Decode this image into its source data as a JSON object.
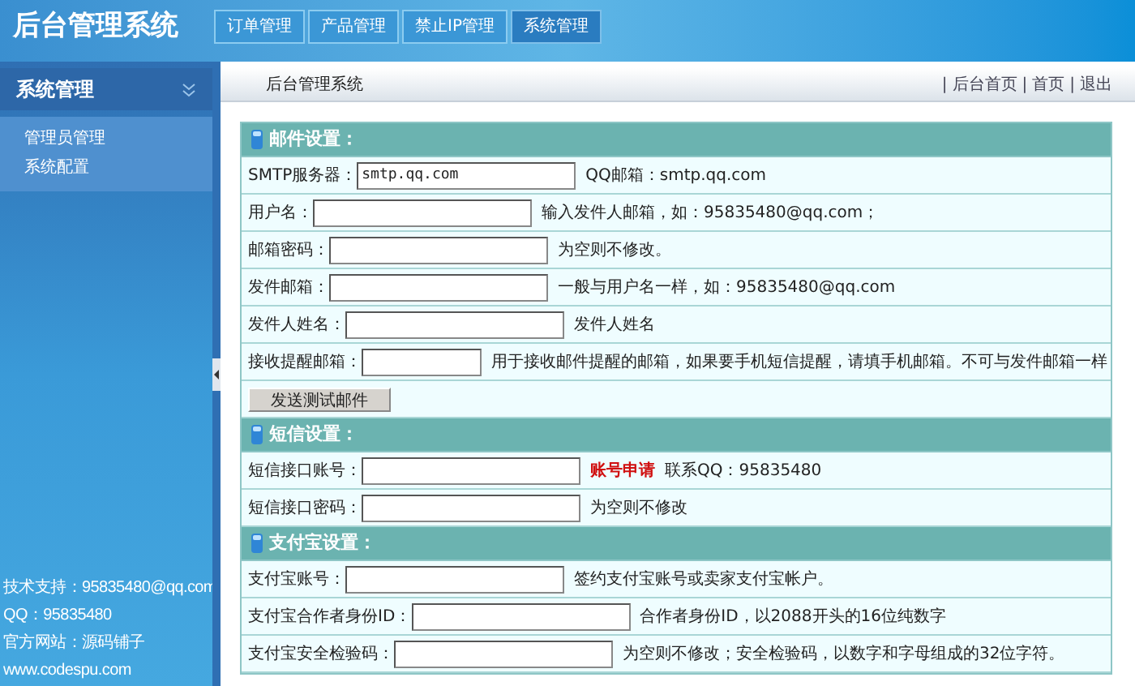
{
  "header": {
    "title": "后台管理系统",
    "tabs": [
      {
        "label": "订单管理",
        "selected": false
      },
      {
        "label": "产品管理",
        "selected": false
      },
      {
        "label": "禁止IP管理",
        "selected": false
      },
      {
        "label": "系统管理",
        "selected": true
      }
    ]
  },
  "sidebar": {
    "title": "系统管理",
    "items": [
      {
        "label": "管理员管理"
      },
      {
        "label": "系统配置"
      }
    ],
    "footer": [
      "技术支持：95835480@qq.com",
      "QQ：95835480",
      "官方网站：源码铺子",
      "www.codespu.com"
    ]
  },
  "topbar": {
    "title": "后台管理系统",
    "separator": "|",
    "links": [
      "后台首页",
      "首页",
      "退出"
    ]
  },
  "sections": [
    {
      "title": "邮件设置：",
      "rows": [
        {
          "kind": "field",
          "label": "SMTP服务器：",
          "value": "smtp.qq.com",
          "hint": "QQ邮箱：smtp.qq.com"
        },
        {
          "kind": "field",
          "label": "用户名：",
          "hint": "输入发件人邮箱，如：95835480@qq.com；"
        },
        {
          "kind": "field",
          "label": "邮箱密码：",
          "hint": "为空则不修改。"
        },
        {
          "kind": "field",
          "label": "发件邮箱：",
          "hint": "一般与用户名一样，如：95835480@qq.com"
        },
        {
          "kind": "field",
          "label": "发件人姓名：",
          "hint": "发件人姓名"
        },
        {
          "kind": "field",
          "label": "接收提醒邮箱：",
          "hint": "用于接收邮件提醒的邮箱，如果要手机短信提醒，请填手机邮箱。不可与发件邮箱一样"
        },
        {
          "kind": "button",
          "label": "发送测试邮件"
        }
      ]
    },
    {
      "title": "短信设置：",
      "rows": [
        {
          "kind": "field",
          "label": "短信接口账号：",
          "link": "账号申请",
          "hint": "联系QQ：95835480"
        },
        {
          "kind": "field",
          "label": "短信接口密码：",
          "hint": "为空则不修改"
        }
      ]
    },
    {
      "title": "支付宝设置：",
      "rows": [
        {
          "kind": "field",
          "label": "支付宝账号：",
          "hint": "签约支付宝账号或卖家支付宝帐户。"
        },
        {
          "kind": "field",
          "label": "支付宝合作者身份ID：",
          "hint": "合作者身份ID，以2088开头的16位纯数字"
        },
        {
          "kind": "field",
          "label": "支付宝安全检验码：",
          "hint": "为空则不修改；安全检验码，以数字和字母组成的32位字符。"
        }
      ]
    }
  ]
}
